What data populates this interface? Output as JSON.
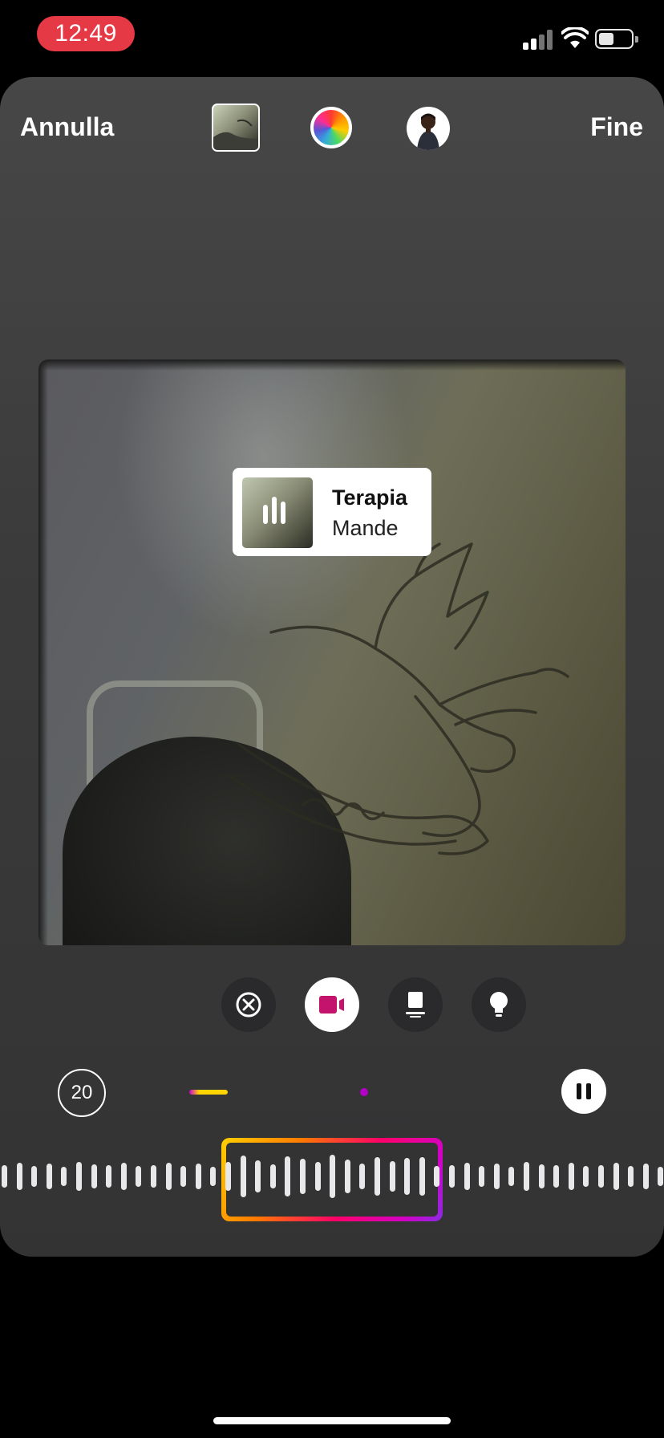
{
  "status_bar": {
    "time": "12:49",
    "icons": [
      "signal-icon",
      "wifi-icon",
      "battery-icon"
    ],
    "time_pill_color": "#e53945"
  },
  "header": {
    "cancel_label": "Annulla",
    "done_label": "Fine",
    "icons": [
      "photo-thumbnail",
      "color-wheel-icon",
      "avatar-icon"
    ]
  },
  "music_sticker": {
    "title": "Terapia",
    "artist": "Mande",
    "state_icon": "equalizer-icon"
  },
  "sticker_styles": {
    "icons": [
      "close-circle-icon",
      "video-camera-icon",
      "card-icon",
      "lightbulb-icon"
    ],
    "active": "video-camera-icon",
    "active_color": "#c4136c"
  },
  "playback": {
    "duration": "20",
    "pause_icon": "pause-icon"
  },
  "colors": {
    "accent_gradient": [
      "#ffd000",
      "#ff7a00",
      "#ff0069",
      "#d300c5",
      "#8a2be2"
    ],
    "sheet_background": "#3b3b3b"
  }
}
